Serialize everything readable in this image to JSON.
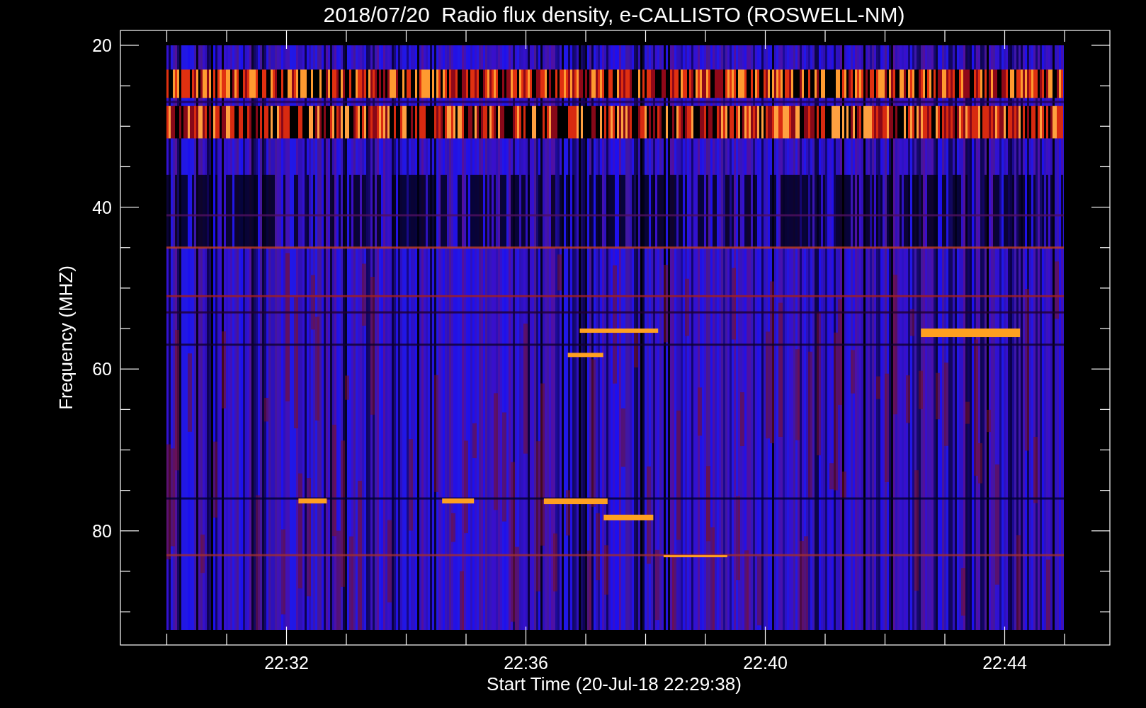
{
  "title": "2018/07/20  Radio flux density, e-CALLISTO (ROSWELL-NM)",
  "y_axis": {
    "label": "Frequency (MHZ)",
    "ticks": [
      "20",
      "40",
      "60",
      "80"
    ]
  },
  "x_axis": {
    "label": "Start Time (20-Jul-18 22:29:38)",
    "ticks": [
      "22:32",
      "22:36",
      "22:40",
      "22:44"
    ]
  }
}
